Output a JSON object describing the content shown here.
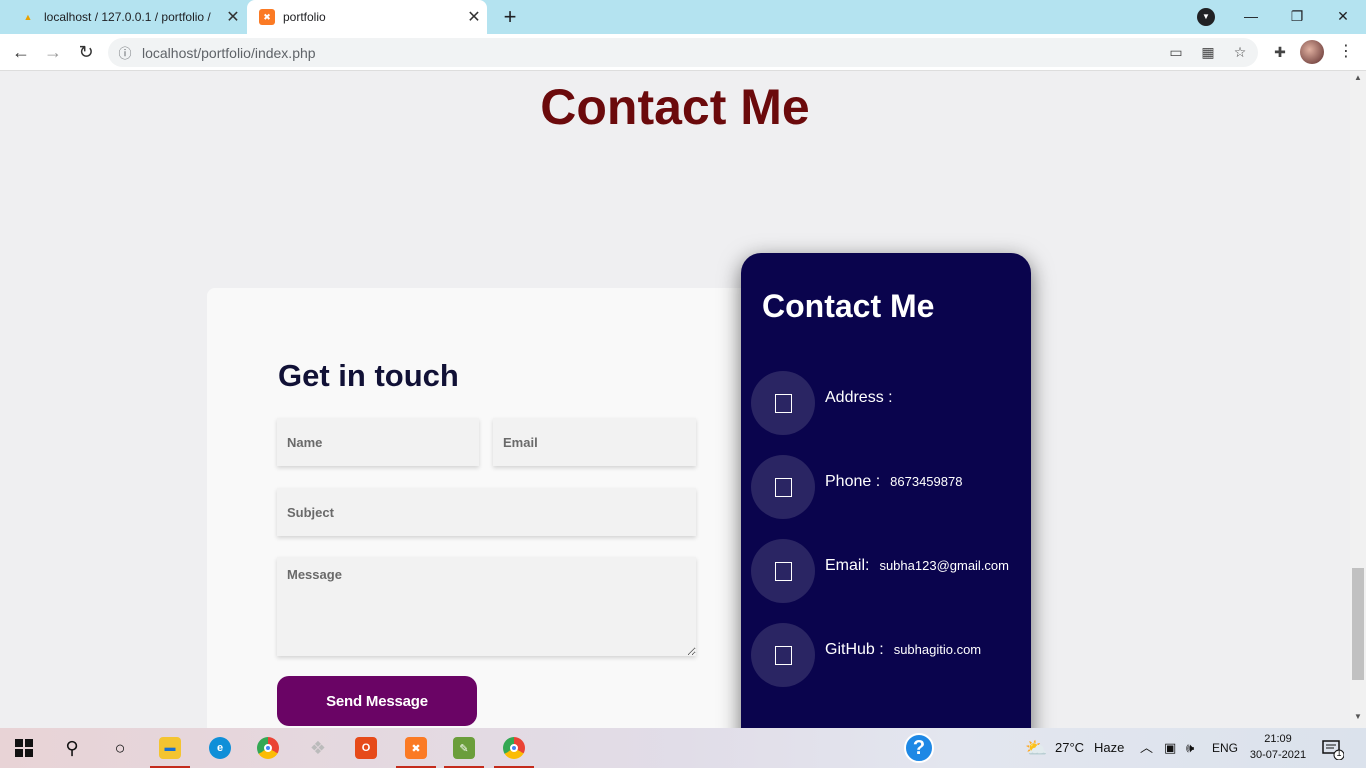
{
  "browser": {
    "tabs": [
      {
        "title": "localhost / 127.0.0.1 / portfolio / ",
        "favicon": "phpmyadmin-icon",
        "active": false
      },
      {
        "title": "portfolio",
        "favicon": "xampp-icon",
        "active": true
      }
    ],
    "url": "localhost/portfolio/index.php"
  },
  "page": {
    "title": "Contact Me",
    "form": {
      "heading": "Get in touch",
      "name_placeholder": "Name",
      "email_placeholder": "Email",
      "subject_placeholder": "Subject",
      "message_placeholder": "Message",
      "submit_label": "Send Message"
    },
    "info": {
      "title": "Contact Me",
      "items": [
        {
          "label": "Address :",
          "value": ""
        },
        {
          "label": "Phone :",
          "value": "8673459878"
        },
        {
          "label": "Email:",
          "value": "subha123@gmail.com"
        },
        {
          "label": "GitHub :",
          "value": "subhagitio.com"
        }
      ]
    }
  },
  "taskbar": {
    "weather_temp": "27°C",
    "weather_desc": "Haze",
    "language": "ENG",
    "time": "21:09",
    "date": "30-07-2021",
    "notification_count": "1"
  },
  "colors": {
    "page_title": "#6b0a0c",
    "info_card_bg": "#0a044d",
    "send_button_bg": "#6a0465",
    "tabstrip_bg": "#b4e3f0"
  }
}
